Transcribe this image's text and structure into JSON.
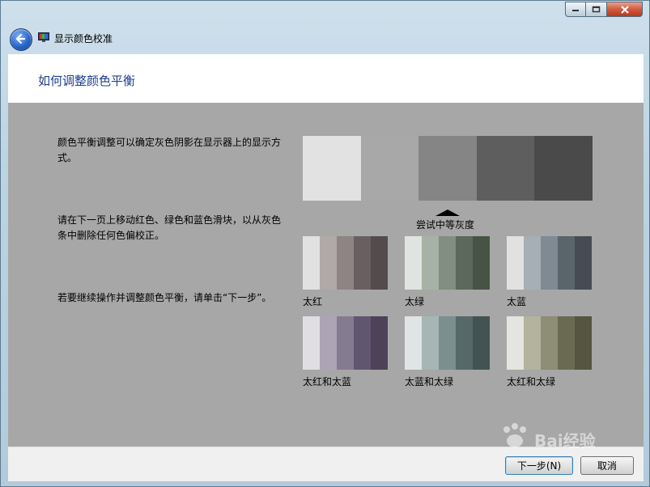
{
  "window": {
    "title": "显示颜色校准"
  },
  "header": {
    "title": "如何调整颜色平衡"
  },
  "content": {
    "paragraphs": [
      "颜色平衡调整可以确定灰色阴影在显示器上的显示方式。",
      "请在下一页上移动红色、绿色和蓝色滑块，以从灰色条中删除任何色偏校正。",
      "若要继续操作并调整颜色平衡，请单击“下一步”。"
    ],
    "gray_strip_colors": [
      "#e2e2e2",
      "#a8a8a8",
      "#858585",
      "#5e5e5e",
      "#4a4a4a"
    ],
    "pointer_label": "尝试中等灰度",
    "swatches": [
      {
        "label": "太红",
        "colors": [
          "#e1e1e1",
          "#b1a9a8",
          "#8d8483",
          "#6a5f60",
          "#544b4c"
        ]
      },
      {
        "label": "太绿",
        "colors": [
          "#e0e4e0",
          "#a6b2a5",
          "#818e80",
          "#5b685b",
          "#475345"
        ]
      },
      {
        "label": "太蓝",
        "colors": [
          "#e1e1e1",
          "#a6afb5",
          "#7f8a92",
          "#5a646b",
          "#454c53"
        ]
      },
      {
        "label": "太红和太蓝",
        "colors": [
          "#e0dde3",
          "#ada4b6",
          "#857b91",
          "#615670",
          "#4d4257"
        ]
      },
      {
        "label": "太蓝和太绿",
        "colors": [
          "#e0e4e4",
          "#a5b6b5",
          "#7b8f8e",
          "#566868",
          "#425352"
        ]
      },
      {
        "label": "太红和太绿",
        "colors": [
          "#e4e4e0",
          "#b3b39e",
          "#8e8d75",
          "#6a6a52",
          "#555540"
        ]
      }
    ]
  },
  "footer": {
    "next_label": "下一步(N)",
    "cancel_label": "取消"
  },
  "watermark": {
    "text": "Bai经验"
  }
}
